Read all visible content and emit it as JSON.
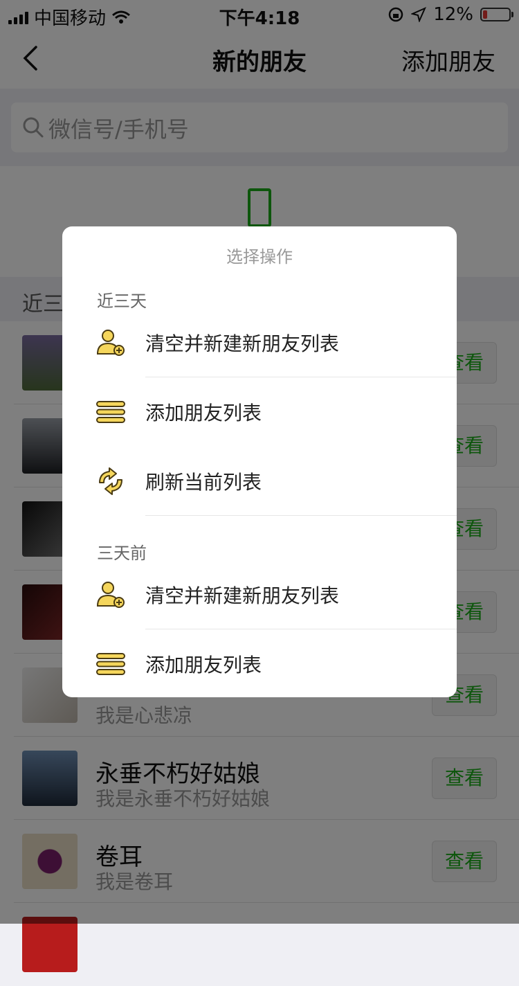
{
  "status_bar": {
    "carrier": "中国移动",
    "time": "下午4:18",
    "battery": "12%"
  },
  "nav": {
    "back_icon": "chevron-left-icon",
    "title": "新的朋友",
    "right_action": "添加朋友"
  },
  "search": {
    "placeholder": "微信号/手机号"
  },
  "section": {
    "label": "近三"
  },
  "list": [
    {
      "name": "",
      "desc": "",
      "button": "查看",
      "avatar_color": "#6b5a8c"
    },
    {
      "name": "",
      "desc": "",
      "button": "查看",
      "avatar_color": "#4a4d52"
    },
    {
      "name": "",
      "desc": "",
      "button": "查看",
      "avatar_color": "#2b2b2b"
    },
    {
      "name": "",
      "desc": "",
      "button": "查看",
      "avatar_color": "#5a1e1e"
    },
    {
      "name": "",
      "desc": "我是心悲凉",
      "button": "查看",
      "avatar_color": "#d9d4cc"
    },
    {
      "name": "永垂不朽好姑娘",
      "desc": "我是永垂不朽好姑娘",
      "button": "查看",
      "avatar_color": "#3a4a63"
    },
    {
      "name": "卷耳",
      "desc": "我是卷耳",
      "button": "查看",
      "avatar_color": "#c9a66b"
    }
  ],
  "dialog": {
    "title": "选择操作",
    "sections": [
      {
        "label": "近三天",
        "items": [
          {
            "icon": "add-user-icon",
            "label": "清空并新建新朋友列表"
          },
          {
            "icon": "list-icon",
            "label": "添加朋友列表"
          },
          {
            "icon": "refresh-icon",
            "label": "刷新当前列表"
          }
        ]
      },
      {
        "label": "三天前",
        "items": [
          {
            "icon": "add-user-icon",
            "label": "清空并新建新朋友列表"
          },
          {
            "icon": "list-icon",
            "label": "添加朋友列表"
          }
        ]
      }
    ]
  },
  "colors": {
    "accent_green": "#1aad19",
    "icon_yellow": "#f5d65c",
    "icon_outline": "#4a3b12"
  }
}
